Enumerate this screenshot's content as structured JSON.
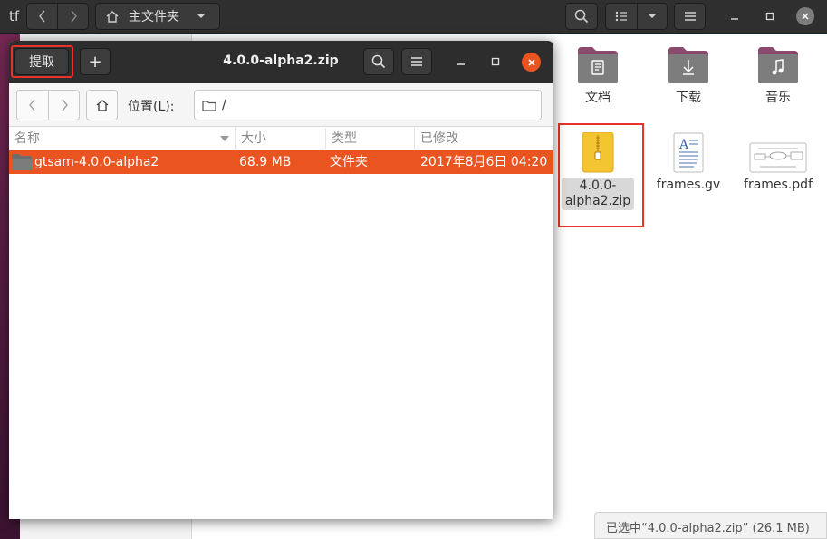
{
  "background_window": {
    "app_title": "tf",
    "path_label": "主文件夹",
    "items": [
      {
        "label": "文档",
        "icon": "folder-documents-icon"
      },
      {
        "label": "下载",
        "icon": "folder-download-icon"
      },
      {
        "label": "音乐",
        "icon": "folder-music-icon"
      },
      {
        "label": "4.0.0-alpha2.zip",
        "label_line1": "4.0.0-",
        "label_line2": "alpha2.zip",
        "icon": "zip-archive-icon"
      },
      {
        "label": "frames.gv",
        "icon": "text-document-icon"
      },
      {
        "label": "frames.pdf",
        "icon": "pdf-document-icon"
      }
    ],
    "status": "已选中“4.0.0-alpha2.zip” (26.1 MB)"
  },
  "archive_window": {
    "title": "4.0.0-alpha2.zip",
    "extract_label": "提取",
    "add_label": "+",
    "location_label": "位置(L):",
    "location_path": "/",
    "columns": {
      "name": "名称",
      "size": "大小",
      "type": "类型",
      "modified": "已修改"
    },
    "rows": [
      {
        "name": "gtsam-4.0.0-alpha2",
        "size": "68.9 MB",
        "type": "文件夹",
        "modified": "2017年8月6日 04:20"
      }
    ]
  },
  "colors": {
    "accent": "#e95420",
    "highlight_box": "#e8322a",
    "header_dark": "#2d2d2d",
    "folder": "#7d7d7d"
  }
}
